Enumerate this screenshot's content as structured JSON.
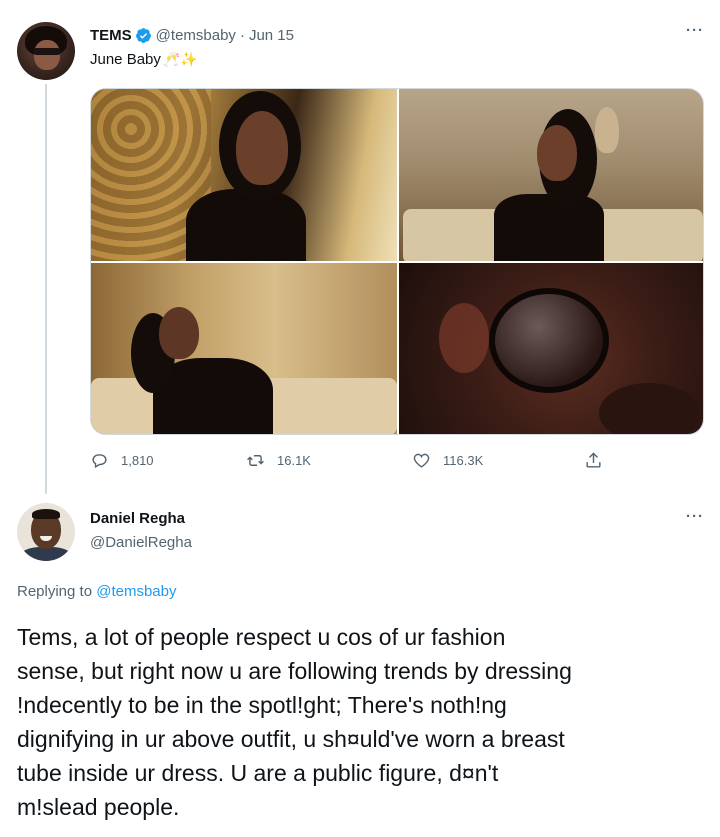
{
  "parent_tweet": {
    "author_name": "TEMS",
    "handle": "@temsbaby",
    "separator": "·",
    "date": "Jun 15",
    "text": "June Baby",
    "emoji": "🥂✨",
    "more_label": "···",
    "verified": true,
    "media_count": 4,
    "actions": {
      "reply_count": "1,810",
      "retweet_count": "16.1K",
      "like_count": "116.3K"
    }
  },
  "reply_tweet": {
    "author_name": "Daniel Regha",
    "handle": "@DanielRegha",
    "more_label": "···",
    "replying_prefix": "Replying to",
    "replying_to": "@temsbaby",
    "text": "Tems, a lot of people respect u cos of ur fashion\nsense, but right now u are following trends by dressing\n!ndecently to be in the spotl!ght; There's noth!ng\ndignifying in ur above outfit, u sh¤uld've worn a breast\ntube inside ur dress. U are a public figure, d¤n't\nm!slead people."
  },
  "colors": {
    "text_primary": "#0f1419",
    "text_secondary": "#536471",
    "accent_blue": "#1d9bf0",
    "border": "#cfd9de"
  },
  "icons": [
    "verified-badge-icon",
    "more-icon",
    "reply-icon",
    "retweet-icon",
    "like-icon",
    "share-icon"
  ]
}
